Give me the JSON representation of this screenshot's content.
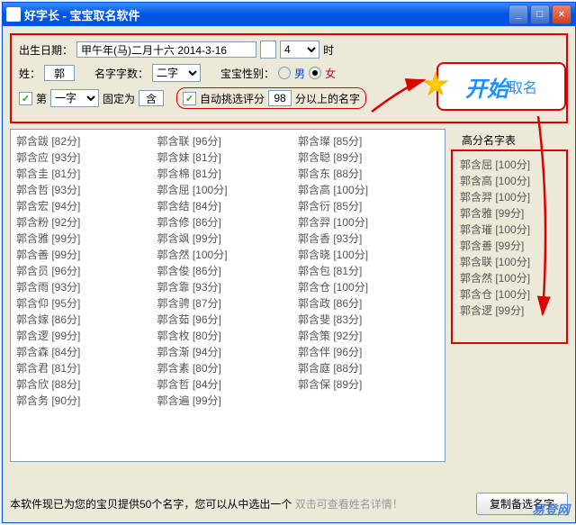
{
  "window": {
    "title": "好字长 - 宝宝取名软件"
  },
  "form": {
    "birth_label": "出生日期：",
    "birth_value": "甲午年(马)二月十六 2014-3-16",
    "hour_value": "4",
    "hour_unit": "时",
    "surname_label": "姓：",
    "surname_value": "郭",
    "charcnt_label": "名字字数：",
    "charcnt_value": "二字",
    "gender_label": "宝宝性别：",
    "gender_male": "男",
    "gender_female": "女",
    "chk_di": "第",
    "pos_value": "一字",
    "fix_label": "固定为",
    "fix_value": "含",
    "auto_label": "自动挑选评分",
    "auto_value": "98",
    "auto_tail": "分以上的名字"
  },
  "start": {
    "big": "开始",
    "small": "取名"
  },
  "list": {
    "rows": [
      [
        "郭含跋  [82分]",
        "郭含联  [96分]",
        "郭含璨  [85分]"
      ],
      [
        "郭含应  [93分]",
        "郭含妹  [81分]",
        "郭含聪  [89分]"
      ],
      [
        "郭含圭  [81分]",
        "郭含棉  [81分]",
        "郭含东  [88分]"
      ],
      [
        "郭含哲  [93分]",
        "郭含屈  [100分]",
        "郭含高  [100分]"
      ],
      [
        "郭含宏  [94分]",
        "郭含结  [84分]",
        "郭含衍  [85分]"
      ],
      [
        "郭含粉  [92分]",
        "郭含修  [86分]",
        "郭含羿  [100分]"
      ],
      [
        "郭含雅  [99分]",
        "郭含飒  [99分]",
        "郭含香  [93分]"
      ],
      [
        "郭含善  [99分]",
        "郭含然  [100分]",
        "郭含晓  [100分]"
      ],
      [
        "郭含员  [96分]",
        "郭含俊  [86分]",
        "郭含包  [81分]"
      ],
      [
        "郭含雨  [93分]",
        "郭含靠  [93分]",
        "郭含仓  [100分]"
      ],
      [
        "郭含仰  [95分]",
        "郭含骋  [87分]",
        "郭含政  [86分]"
      ],
      [
        "郭含嫁  [86分]",
        "郭含茹  [96分]",
        "郭含斐  [83分]"
      ],
      [
        "郭含逻  [99分]",
        "郭含枚  [80分]",
        "郭含策  [92分]"
      ],
      [
        "郭含森  [84分]",
        "郭含渐  [94分]",
        "郭含伴  [96分]"
      ],
      [
        "郭含君  [81分]",
        "郭含素  [80分]",
        "郭含庭  [88分]"
      ],
      [
        "郭含欣  [88分]",
        "郭含哲  [84分]",
        "郭含保  [89分]"
      ],
      [
        "郭含务  [90分]",
        "郭含遍  [99分]",
        ""
      ]
    ]
  },
  "side": {
    "header": "高分名字表",
    "items": [
      "郭含屈  [100分]",
      "郭含高  [100分]",
      "郭含羿  [100分]",
      "郭含雅  [99分]",
      "郭含璀  [100分]",
      "郭含善  [99分]",
      "郭含联  [100分]",
      "郭含然  [100分]",
      "郭含仓  [100分]",
      "郭含逻  [99分]"
    ]
  },
  "footer": {
    "msg": "本软件现已为您的宝贝提供50个名字，您可以从中选出一个",
    "hint": "双击可查看姓名详情！",
    "copy_btn": "复制备选名字"
  },
  "watermark": "易登网"
}
